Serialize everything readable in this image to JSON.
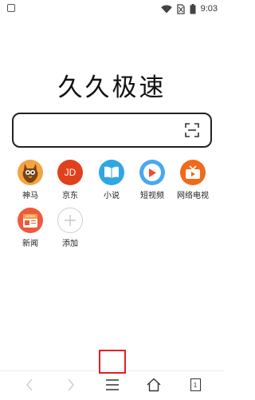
{
  "status_bar": {
    "time": "9:03"
  },
  "app": {
    "title": "久久极速"
  },
  "search": {
    "value": "",
    "placeholder": ""
  },
  "shortcuts": [
    {
      "label": "神马",
      "icon": "shenma-icon",
      "color": "#f07a1d"
    },
    {
      "label": "京东",
      "icon": "jd-icon",
      "color": "#e0401c",
      "text": "JD"
    },
    {
      "label": "小说",
      "icon": "book-icon",
      "color": "#2da7e6"
    },
    {
      "label": "短视频",
      "icon": "play-icon",
      "color": "#3aa0f0"
    },
    {
      "label": "网络电视",
      "icon": "tv-icon",
      "color": "#f06a1a"
    },
    {
      "label": "新闻",
      "icon": "news-icon",
      "color": "#f0593c",
      "text": "NEWS"
    },
    {
      "label": "添加",
      "icon": "add-icon",
      "color": "#cccccc"
    }
  ],
  "bottom_bar": {
    "tab_count": "1",
    "highlight_color": "#e02020"
  }
}
